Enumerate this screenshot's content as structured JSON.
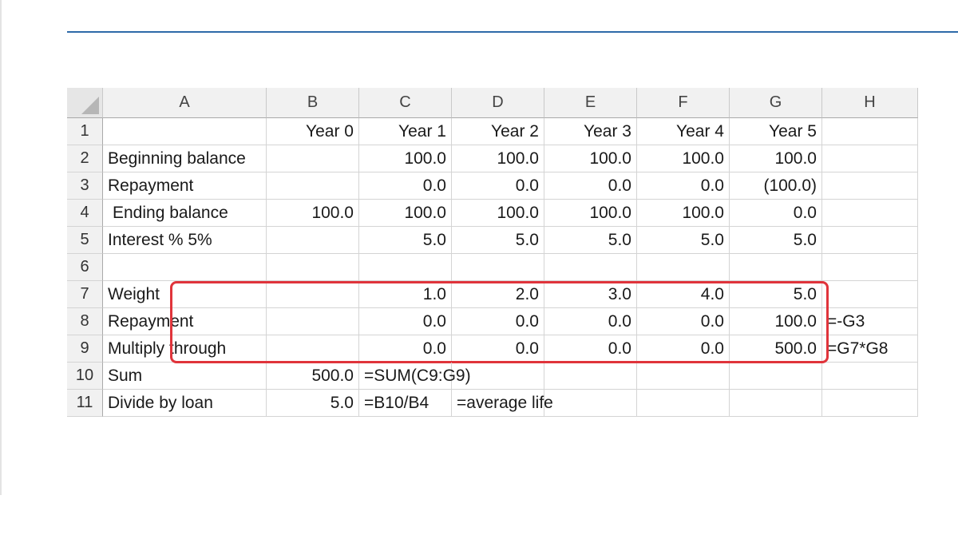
{
  "sheet": {
    "col_headers": [
      "A",
      "B",
      "C",
      "D",
      "E",
      "F",
      "G",
      "H"
    ],
    "rows": [
      {
        "num": "1",
        "cells": [
          "",
          "Year 0",
          "Year 1",
          "Year 2",
          "Year 3",
          "Year 4",
          "Year 5",
          ""
        ]
      },
      {
        "num": "2",
        "cells": [
          "Beginning balance",
          "",
          "100.0",
          "100.0",
          "100.0",
          "100.0",
          "100.0",
          ""
        ]
      },
      {
        "num": "3",
        "cells": [
          "Repayment",
          "",
          "0.0",
          "0.0",
          "0.0",
          "0.0",
          "(100.0)",
          ""
        ]
      },
      {
        "num": "4",
        "cells": [
          "Ending balance",
          "100.0",
          "100.0",
          "100.0",
          "100.0",
          "100.0",
          "0.0",
          ""
        ]
      },
      {
        "num": "5",
        "cells": [
          "Interest % 5%",
          "",
          "5.0",
          "5.0",
          "5.0",
          "5.0",
          "5.0",
          ""
        ]
      },
      {
        "num": "6",
        "cells": [
          "",
          "",
          "",
          "",
          "",
          "",
          "",
          ""
        ]
      },
      {
        "num": "7",
        "cells": [
          "Weight",
          "",
          "1.0",
          "2.0",
          "3.0",
          "4.0",
          "5.0",
          ""
        ]
      },
      {
        "num": "8",
        "cells": [
          "Repayment",
          "",
          "0.0",
          "0.0",
          "0.0",
          "0.0",
          "100.0",
          "=-G3"
        ]
      },
      {
        "num": "9",
        "cells": [
          "Multiply through",
          "",
          "0.0",
          "0.0",
          "0.0",
          "0.0",
          "500.0",
          "=G7*G8"
        ]
      },
      {
        "num": "10",
        "cells": [
          "Sum",
          "500.0",
          "=SUM(C9:G9)",
          "",
          "",
          "",
          "",
          ""
        ]
      },
      {
        "num": "11",
        "cells": [
          "Divide by loan",
          "5.0",
          "=B10/B4",
          "=average life",
          "",
          "",
          "",
          ""
        ]
      }
    ]
  },
  "colors": {
    "title_rule": "#2e6aa8",
    "highlight": "#e0343b",
    "header_bg": "#f1f1f1",
    "grid": "#d4d4d4"
  },
  "icons": {
    "corner": "select-all-triangle-icon"
  }
}
